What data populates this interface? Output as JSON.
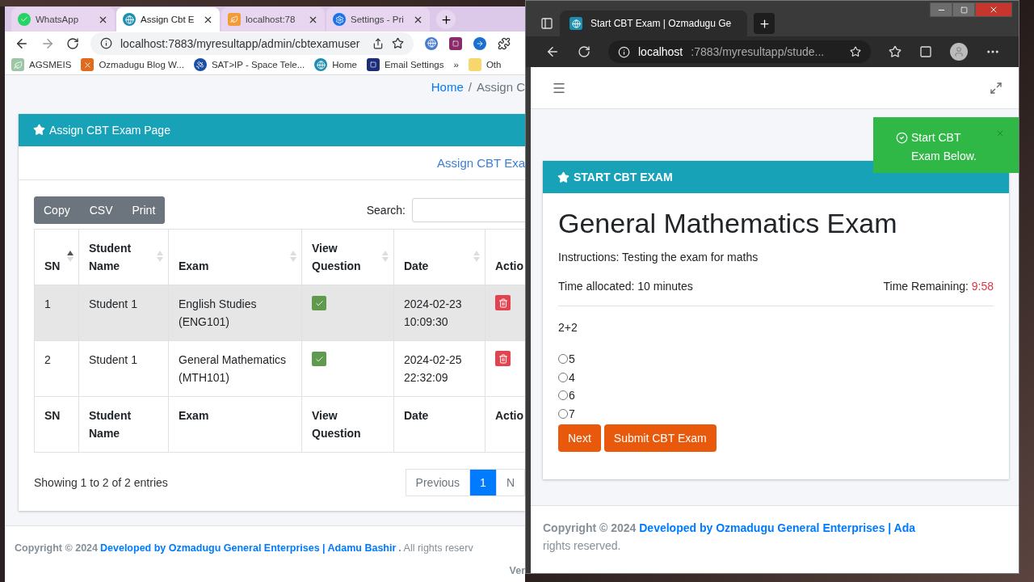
{
  "left_browser": {
    "tabs": [
      {
        "title": "WhatsApp",
        "selected": false
      },
      {
        "title": "Assign Cbt E",
        "selected": true
      },
      {
        "title": "localhost:78",
        "selected": false
      },
      {
        "title": "Settings - Pri",
        "selected": false
      }
    ],
    "address": "localhost:7883/myresultapp/admin/cbtexamuser",
    "bookmarks": [
      {
        "label": "AGSMEIS"
      },
      {
        "label": "Ozmadugu Blog W..."
      },
      {
        "label": "SAT>IP - Space Tele..."
      },
      {
        "label": "Home"
      },
      {
        "label": "Email Settings"
      }
    ],
    "bookmarks_more": "»",
    "other_bookmarks": "Oth",
    "breadcrumb_separator": "/",
    "breadcrumb": [
      {
        "label": "Home",
        "link": true
      },
      {
        "label": "Assign C",
        "link": false
      }
    ],
    "card": {
      "title": "Assign CBT Exam Page",
      "link": "Assign CBT Exa",
      "export_buttons": [
        "Copy",
        "CSV",
        "Print"
      ],
      "search_label": "Search:",
      "table": {
        "columns": [
          {
            "label": "SN",
            "sorted": true
          },
          {
            "label": "Student Name",
            "sorted": false
          },
          {
            "label": "Exam",
            "sorted": false
          },
          {
            "label": "View Question",
            "sorted": false
          },
          {
            "label": "Date",
            "sorted": false
          },
          {
            "label": "Actio"
          }
        ],
        "rows": [
          {
            "sn": "1",
            "student": "Student 1",
            "exam": "English Studies (ENG101)",
            "date": "2024-02-23 10:09:30",
            "hovered": true
          },
          {
            "sn": "2",
            "student": "Student 1",
            "exam": "General Mathematics (MTH101)",
            "date": "2024-02-25 22:32:09",
            "hovered": false
          }
        ],
        "footer_columns": [
          "SN",
          "Student Name",
          "Exam",
          "View Question",
          "Date",
          "Actio"
        ]
      },
      "info": "Showing 1 to 2 of 2 entries",
      "pagination": [
        {
          "label": "Previous",
          "selected": false
        },
        {
          "label": "1",
          "selected": true
        },
        {
          "label": "N",
          "selected": false
        }
      ]
    },
    "footer": {
      "copyright": "Copyright © 2024",
      "credit": "Developed by Ozmadugu General Enterprises | Adamu Bashir",
      "rest": ". All rights reserv",
      "version": "Ver"
    }
  },
  "right_browser": {
    "tabs": [
      {
        "title": "Start CBT Exam | Ozmadugu Ge",
        "selected": true
      }
    ],
    "address_host": "localhost",
    "address_path": ":7883/myresultapp/stude...",
    "toast": {
      "message": "Start CBT Exam Below."
    },
    "card": {
      "header": "START CBT EXAM",
      "title": "General Mathematics Exam",
      "instructions": "Instructions: Testing the exam for maths",
      "time_allocated": "Time allocated: 10 minutes",
      "time_remaining_label": "Time Remaining:",
      "time_remaining": "9:58",
      "question": "2+2",
      "options": [
        {
          "label": "5",
          "selected": false
        },
        {
          "label": "4",
          "selected": false
        },
        {
          "label": "6",
          "selected": false
        },
        {
          "label": "7",
          "selected": false
        }
      ],
      "buttons": [
        "Next",
        "Submit CBT Exam"
      ]
    },
    "footer": {
      "copyright": "Copyright © 2024",
      "credit": "Developed by Ozmadugu General Enterprises | Ada",
      "rest": "rights reserved."
    }
  }
}
